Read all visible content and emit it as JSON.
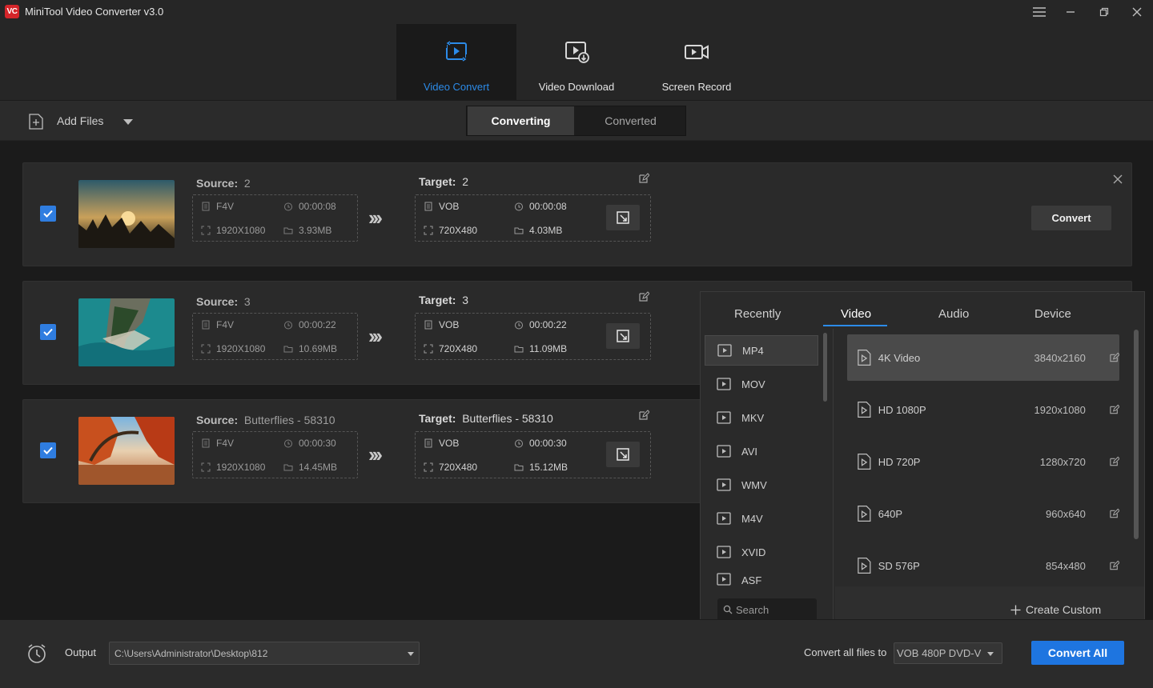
{
  "app": {
    "title": "MiniTool Video Converter v3.0",
    "logo_text": "VC",
    "accent_color": "#2c8be8",
    "logo_color": "#d4252a"
  },
  "window_controls": [
    "menu-icon",
    "minimize-icon",
    "restore-icon",
    "close-icon"
  ],
  "modules": [
    {
      "label": "Video Convert",
      "icon": "video-convert-icon",
      "active": true
    },
    {
      "label": "Video Download",
      "icon": "video-download-icon",
      "active": false
    },
    {
      "label": "Screen Record",
      "icon": "screen-record-icon",
      "active": false
    }
  ],
  "toolbar": {
    "add_files": "Add Files",
    "tabs": [
      {
        "label": "Converting",
        "active": true
      },
      {
        "label": "Converted",
        "active": false
      }
    ]
  },
  "files": [
    {
      "source_label": "Source:",
      "source_name": "2",
      "source_format": "F4V",
      "source_duration": "00:00:08",
      "source_resolution": "1920X1080",
      "source_size": "3.93MB",
      "target_label": "Target:",
      "target_name": "2",
      "target_format": "VOB",
      "target_duration": "00:00:08",
      "target_resolution": "720X480",
      "target_size": "4.03MB",
      "checked": true
    },
    {
      "source_label": "Source:",
      "source_name": "3",
      "source_format": "F4V",
      "source_duration": "00:00:22",
      "source_resolution": "1920X1080",
      "source_size": "10.69MB",
      "target_label": "Target:",
      "target_name": "3",
      "target_format": "VOB",
      "target_duration": "00:00:22",
      "target_resolution": "720X480",
      "target_size": "11.09MB",
      "checked": true
    },
    {
      "source_label": "Source:",
      "source_name": "Butterflies - 58310",
      "source_format": "F4V",
      "source_duration": "00:00:30",
      "source_resolution": "1920X1080",
      "source_size": "14.45MB",
      "target_label": "Target:",
      "target_name": "Butterflies - 58310",
      "target_format": "VOB",
      "target_duration": "00:00:30",
      "target_resolution": "720X480",
      "target_size": "15.12MB",
      "checked": true
    }
  ],
  "row_convert_label": "Convert",
  "format_popup": {
    "tabs": [
      {
        "label": "Recently",
        "active": false
      },
      {
        "label": "Video",
        "active": true
      },
      {
        "label": "Audio",
        "active": false
      },
      {
        "label": "Device",
        "active": false
      }
    ],
    "formats": [
      "MP4",
      "MOV",
      "MKV",
      "AVI",
      "WMV",
      "M4V",
      "XVID",
      "ASF"
    ],
    "selected_format": "MP4",
    "search_placeholder": "Search",
    "presets": [
      {
        "name": "4K Video",
        "resolution": "3840x2160",
        "selected": true
      },
      {
        "name": "HD 1080P",
        "resolution": "1920x1080",
        "selected": false
      },
      {
        "name": "HD 720P",
        "resolution": "1280x720",
        "selected": false
      },
      {
        "name": "640P",
        "resolution": "960x640",
        "selected": false
      },
      {
        "name": "SD 576P",
        "resolution": "854x480",
        "selected": false
      }
    ],
    "create_custom": "Create Custom"
  },
  "bottom": {
    "output_label": "Output",
    "output_path": "C:\\Users\\Administrator\\Desktop\\812",
    "convert_all_to_label": "Convert all files to",
    "convert_all_to_value": "VOB 480P DVD-V",
    "convert_all_label": "Convert All"
  }
}
